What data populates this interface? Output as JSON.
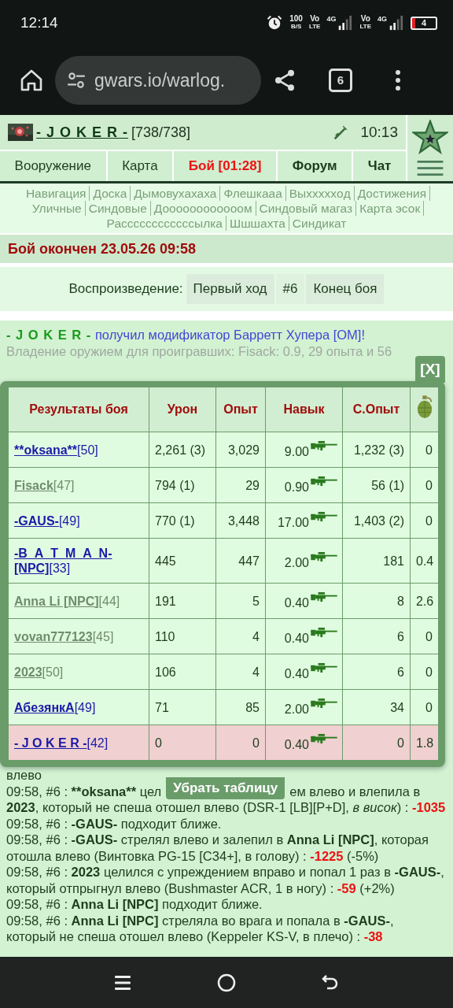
{
  "status_bar": {
    "time": "12:14",
    "speed": "100",
    "speed_unit": "B/S",
    "sims": [
      {
        "volte": "Vo",
        "lte": "LTE",
        "network": "4G"
      },
      {
        "volte": "Vo",
        "lte": "LTE",
        "network": "4G"
      }
    ],
    "battery": "4"
  },
  "browser": {
    "url": "gwars.io/warlog.",
    "tab_count": "6"
  },
  "header": {
    "player": "- J O K E R -",
    "health": "[738/738]",
    "time": "10:13"
  },
  "nav_tabs": [
    {
      "label": "Вооружение",
      "kind": "normal"
    },
    {
      "label": "Карта",
      "kind": "normal"
    },
    {
      "label": "Бой [01:28]",
      "kind": "alert"
    },
    {
      "label": "Форум",
      "kind": "bold"
    },
    {
      "label": "Чат",
      "kind": "bold"
    }
  ],
  "links": [
    "Навигация",
    "Доска",
    "Дымовухахаха",
    "Флешкааа",
    "Выхххххoд",
    "Достижения",
    "Уличные",
    "Синдовые",
    "Доооооооооооом",
    "Синдовый магаз",
    "Карта эсок",
    "Рассссссссссссылка",
    "Шшшахта",
    "Синдикат"
  ],
  "battle_status": "Бой окончен 23.05.26 09:58",
  "replay": {
    "label": "Воспроизведение:",
    "buttons": [
      {
        "label": "Первый ход",
        "kind": "button"
      },
      {
        "label": "#6",
        "kind": "current"
      },
      {
        "label": "Конец боя",
        "kind": "button"
      }
    ]
  },
  "messages": [
    {
      "parts": [
        {
          "kind": "actor",
          "text": "- J O K E R -"
        },
        {
          "kind": "notice",
          "text": " получил модификатор Барретт Хупера [ОМ]!"
        }
      ]
    },
    {
      "parts": [
        {
          "kind": "muted",
          "text": "Владение оружием для проигравших: Fisack: 0.9, 29 опыта и 56"
        }
      ]
    }
  ],
  "results": {
    "close": "[X]",
    "columns": [
      {
        "kind": "text",
        "label": "Результаты боя"
      },
      {
        "kind": "text",
        "label": "Урон"
      },
      {
        "kind": "text",
        "label": "Опыт"
      },
      {
        "kind": "text",
        "label": "Навык"
      },
      {
        "kind": "text",
        "label": "С.Опыт"
      },
      {
        "kind": "grenade"
      }
    ],
    "rows": [
      {
        "name": "**oksana**",
        "rank": "[50]",
        "color": "#1a1aa8",
        "damage": "2,261 (3)",
        "exp": "3,029",
        "skill": "9.00",
        "synd_exp": "1,232 (3)",
        "column_6": "0",
        "highlighted": false
      },
      {
        "name": "Fisack",
        "rank": "[47]",
        "color": "#6f8c6f",
        "damage": "794 (1)",
        "exp": "29",
        "skill": "0.90",
        "synd_exp": "56 (1)",
        "column_6": "0",
        "highlighted": false
      },
      {
        "name": "-GAUS-",
        "rank": "[49]",
        "color": "#1a1aa8",
        "damage": "770 (1)",
        "exp": "3,448",
        "skill": "17.00",
        "synd_exp": "1,403 (2)",
        "column_6": "0",
        "highlighted": false
      },
      {
        "name": "-B_A_T_M_A_N-[NPC]",
        "rank": "[33]",
        "color": "#1a1aa8",
        "damage": "445",
        "exp": "447",
        "skill": "2.00",
        "synd_exp": "181",
        "column_6": "0.4",
        "highlighted": false
      },
      {
        "name": "Anna Li [NPC]",
        "rank": "[44]",
        "color": "#6f8c6f",
        "damage": "191",
        "exp": "5",
        "skill": "0.40",
        "synd_exp": "8",
        "column_6": "2.6",
        "highlighted": false
      },
      {
        "name": "vovan777123",
        "rank": "[45]",
        "color": "#6f8c6f",
        "damage": "110",
        "exp": "4",
        "skill": "0.40",
        "synd_exp": "6",
        "column_6": "0",
        "highlighted": false
      },
      {
        "name": "2023",
        "rank": "[50]",
        "color": "#6f8c6f",
        "damage": "106",
        "exp": "4",
        "skill": "0.40",
        "synd_exp": "6",
        "column_6": "0",
        "highlighted": false
      },
      {
        "name": "АбезянкА",
        "rank": "[49]",
        "color": "#1a1aa8",
        "damage": "71",
        "exp": "85",
        "skill": "2.00",
        "synd_exp": "34",
        "column_6": "0",
        "highlighted": false
      },
      {
        "name": "- J O K E R -",
        "rank": "[42]",
        "color": "#1a1aa8",
        "damage": "0",
        "exp": "0",
        "skill": "0.40",
        "synd_exp": "0",
        "column_6": "1.8",
        "highlighted": true
      }
    ],
    "hide_button": "Убрать таблицу"
  },
  "log": [
    {
      "kind": "line",
      "parts": [
        {
          "kind": "text",
          "text": "влево"
        }
      ]
    },
    {
      "kind": "split",
      "before": [
        {
          "kind": "text",
          "text": "09:58, #6 : "
        },
        {
          "kind": "name",
          "text": "**oksana**"
        },
        {
          "kind": "text",
          "text": " цел"
        }
      ],
      "after": [
        {
          "kind": "text",
          "text": "ем влево и влепила в"
        }
      ]
    },
    {
      "kind": "line",
      "parts": [
        {
          "kind": "name",
          "text": "2023"
        },
        {
          "kind": "text",
          "text": ", который не спеша отошел влево (DSR-1 [LB][P+D], "
        },
        {
          "kind": "italic",
          "text": "в висок"
        },
        {
          "kind": "text",
          "text": ") : "
        },
        {
          "kind": "damage",
          "text": "-1035"
        }
      ]
    },
    {
      "kind": "line",
      "parts": [
        {
          "kind": "text",
          "text": "09:58, #6 : "
        },
        {
          "kind": "name",
          "text": "-GAUS-"
        },
        {
          "kind": "text",
          "text": " подходит ближе."
        }
      ]
    },
    {
      "kind": "line",
      "parts": [
        {
          "kind": "text",
          "text": "09:58, #6 : "
        },
        {
          "kind": "name",
          "text": "-GAUS-"
        },
        {
          "kind": "text",
          "text": " стрелял влево и залепил в "
        },
        {
          "kind": "name",
          "text": "Anna Li [NPC]"
        },
        {
          "kind": "text",
          "text": ", которая отошла влево (Винтовка PG-15 [C34+], в голову) : "
        },
        {
          "kind": "damage",
          "text": "-1225"
        },
        {
          "kind": "text",
          "text": " (-5%)"
        }
      ]
    },
    {
      "kind": "line",
      "parts": [
        {
          "kind": "text",
          "text": "09:58, #6 : "
        },
        {
          "kind": "name",
          "text": "2023"
        },
        {
          "kind": "text",
          "text": " целился с упреждением вправо и попал 1 раз в "
        },
        {
          "kind": "name",
          "text": "-GAUS-"
        },
        {
          "kind": "text",
          "text": ", который отпрыгнул влево (Bushmaster ACR, 1 в ногу) : "
        },
        {
          "kind": "damage",
          "text": "-59"
        },
        {
          "kind": "text",
          "text": " (+2%)"
        }
      ]
    },
    {
      "kind": "line",
      "parts": [
        {
          "kind": "text",
          "text": "09:58, #6 : "
        },
        {
          "kind": "name",
          "text": "Anna Li [NPC]"
        },
        {
          "kind": "text",
          "text": " подходит ближе."
        }
      ]
    },
    {
      "kind": "line",
      "parts": [
        {
          "kind": "text",
          "text": "09:58, #6 : "
        },
        {
          "kind": "name",
          "text": "Anna Li [NPC]"
        },
        {
          "kind": "text",
          "text": " стреляла во врага и попала в "
        },
        {
          "kind": "name",
          "text": "-GAUS-"
        },
        {
          "kind": "text",
          "text": ", который не спеша отошел влево (Keppeler KS-V, в плечо) : "
        },
        {
          "kind": "damage",
          "text": "-38"
        }
      ]
    }
  ]
}
